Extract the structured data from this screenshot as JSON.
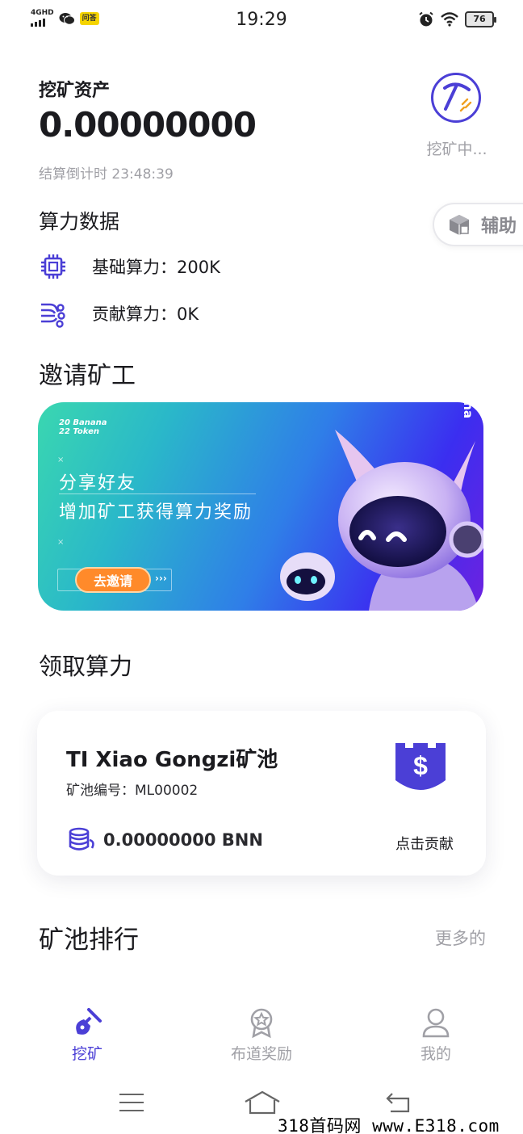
{
  "status_bar": {
    "network": "4GHD",
    "app_badge": "问答",
    "time": "19:29",
    "battery": "76"
  },
  "assets": {
    "title": "挖矿资产",
    "value": "0.00000000",
    "countdown": "结算倒计时 23:48:39",
    "mining_status": "挖矿中..."
  },
  "assist": {
    "label": "辅助"
  },
  "hashrate": {
    "title": "算力数据",
    "base": "基础算力：200K",
    "contribution": "贡献算力：0K"
  },
  "invite": {
    "title": "邀请矿工",
    "banner": {
      "logo_line1": "20 Banana",
      "logo_line2": "22 Token",
      "line1": "分享好友",
      "line2": "增加矿工获得算力奖励",
      "button": "去邀请",
      "arrows": "›››",
      "side_text": "Banana"
    }
  },
  "claim": {
    "title": "领取算力",
    "pool": {
      "name": "TI Xiao Gongzi矿池",
      "id": "矿池编号：ML00002",
      "amount": "0.00000000 BNN",
      "action": "点击贡献"
    }
  },
  "ranking": {
    "title": "矿池排行",
    "more": "更多的"
  },
  "tabs": [
    {
      "label": "挖矿",
      "icon": "pickaxe-icon",
      "active": true
    },
    {
      "label": "布道奖励",
      "icon": "medal-icon",
      "active": false
    },
    {
      "label": "我的",
      "icon": "user-icon",
      "active": false
    }
  ],
  "watermark": "318首码网 www.E318.com",
  "colors": {
    "accent": "#4b3fd6",
    "muted": "#a0a0a6",
    "invite_button": "#ff8a2a"
  }
}
